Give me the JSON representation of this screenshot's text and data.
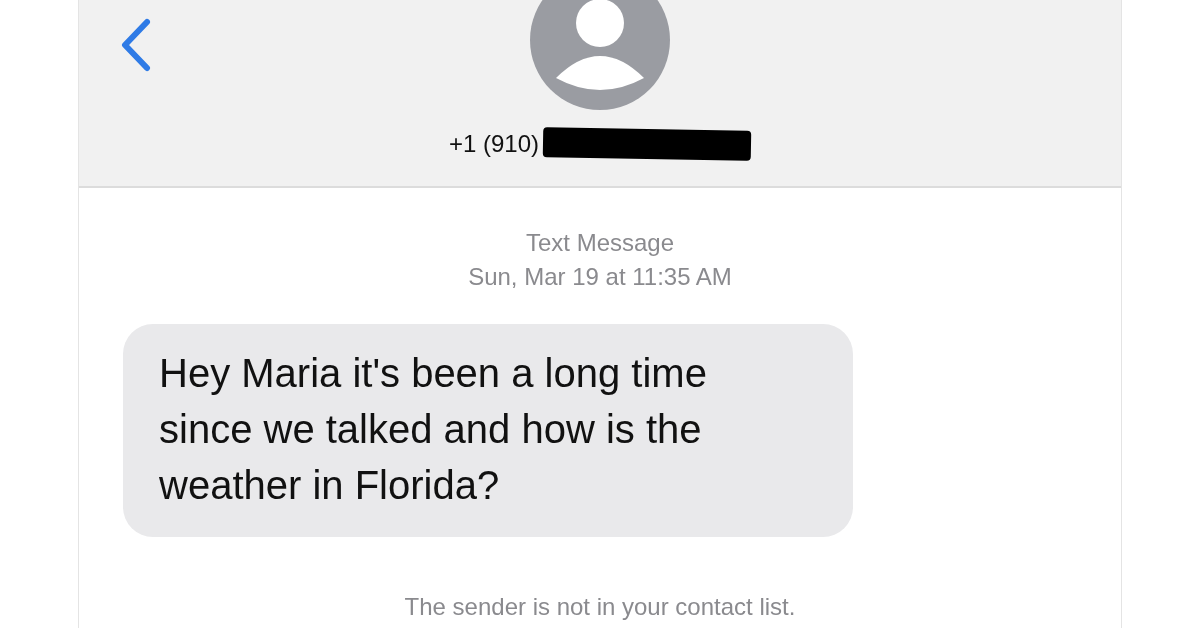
{
  "header": {
    "phone_number": "+1 (910)",
    "redacted": true
  },
  "conversation": {
    "service": "Text Message",
    "timestamp": "Sun, Mar 19 at 11:35 AM",
    "messages": [
      {
        "text": "Hey Maria it's been a long time since we talked and how is the weather in Florida?",
        "incoming": true
      }
    ],
    "notice": "The sender is not in your contact list."
  }
}
